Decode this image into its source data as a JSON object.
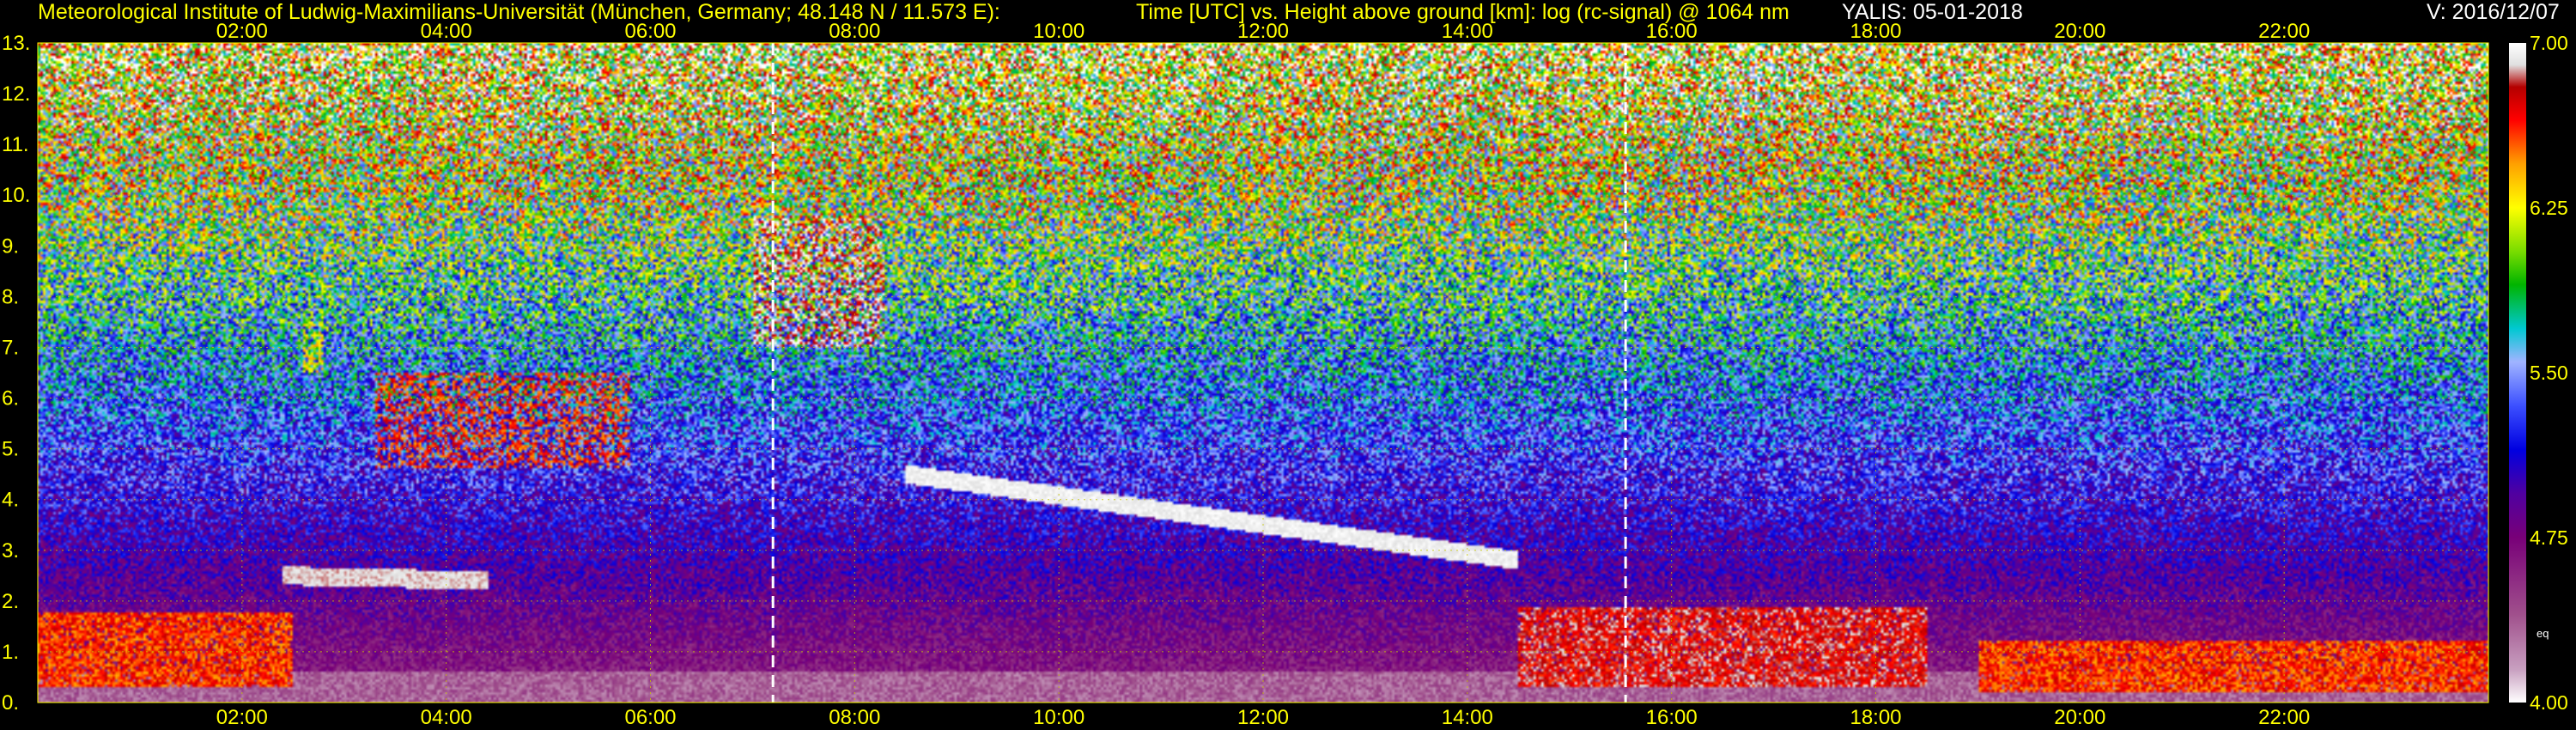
{
  "header": {
    "institute": "Meteorological Institute of Ludwig-Maximilians-Universität (München, Germany; 48.148 N / 11.573 E):",
    "description": "Time [UTC] vs. Height above ground [km]: log (rc-signal) @ 1064 nm",
    "instrument_date": "YALIS: 05-01-2018",
    "version": "V: 2016/12/07"
  },
  "chart_data": {
    "type": "heatmap",
    "title": "Time [UTC] vs. Height above ground [km]: log (rc-signal) @ 1064 nm",
    "x_axis": {
      "unit": "UTC",
      "range_hours": [
        0,
        24
      ],
      "ticks": [
        {
          "hour": 2,
          "label": "02:00"
        },
        {
          "hour": 4,
          "label": "04:00"
        },
        {
          "hour": 6,
          "label": "06:00"
        },
        {
          "hour": 8,
          "label": "08:00"
        },
        {
          "hour": 10,
          "label": "10:00"
        },
        {
          "hour": 12,
          "label": "12:00"
        },
        {
          "hour": 14,
          "label": "14:00"
        },
        {
          "hour": 16,
          "label": "16:00"
        },
        {
          "hour": 18,
          "label": "18:00"
        },
        {
          "hour": 20,
          "label": "20:00"
        },
        {
          "hour": 22,
          "label": "22:00"
        }
      ]
    },
    "y_axis": {
      "unit": "km",
      "range": [
        0,
        13
      ],
      "ticks": [
        {
          "value": 0,
          "label": "0."
        },
        {
          "value": 1,
          "label": "1."
        },
        {
          "value": 2,
          "label": "2."
        },
        {
          "value": 3,
          "label": "3."
        },
        {
          "value": 4,
          "label": "4."
        },
        {
          "value": 5,
          "label": "5."
        },
        {
          "value": 6,
          "label": "6."
        },
        {
          "value": 7,
          "label": "7."
        },
        {
          "value": 8,
          "label": "8."
        },
        {
          "value": 9,
          "label": "9."
        },
        {
          "value": 10,
          "label": "10."
        },
        {
          "value": 11,
          "label": "11."
        },
        {
          "value": 12,
          "label": "12."
        },
        {
          "value": 13,
          "label": "13."
        }
      ]
    },
    "grid": true,
    "grid_color": "#c8c800",
    "marker_lines_hours": [
      7.2,
      15.55
    ],
    "colorbar": {
      "range": [
        4.0,
        7.0
      ],
      "ticks": [
        {
          "value": 7.0,
          "label": "7.00"
        },
        {
          "value": 6.25,
          "label": "6.25"
        },
        {
          "value": 5.5,
          "label": "5.50"
        },
        {
          "value": 4.75,
          "label": "4.75"
        },
        {
          "value": 4.0,
          "label": "4.00"
        }
      ],
      "unit_label": "eq",
      "stops": [
        {
          "value": 4.0,
          "color": "#ffffff"
        },
        {
          "value": 4.15,
          "color": "#c8a0c0"
        },
        {
          "value": 4.4,
          "color": "#a0508c"
        },
        {
          "value": 4.75,
          "color": "#780078"
        },
        {
          "value": 4.95,
          "color": "#5000a0"
        },
        {
          "value": 5.15,
          "color": "#0000e0"
        },
        {
          "value": 5.35,
          "color": "#3c50ff"
        },
        {
          "value": 5.55,
          "color": "#a0b4ff"
        },
        {
          "value": 5.7,
          "color": "#00c8d2"
        },
        {
          "value": 5.9,
          "color": "#00b400"
        },
        {
          "value": 6.05,
          "color": "#78dc00"
        },
        {
          "value": 6.25,
          "color": "#ffff00"
        },
        {
          "value": 6.45,
          "color": "#ffa000"
        },
        {
          "value": 6.65,
          "color": "#ff0000"
        },
        {
          "value": 6.8,
          "color": "#b40000"
        },
        {
          "value": 6.9,
          "color": "#e0e0e0"
        },
        {
          "value": 7.0,
          "color": "#ffffff"
        }
      ]
    },
    "features": [
      {
        "kind": "cirrus",
        "t0": 7.0,
        "t1": 8.3,
        "h0": 7.0,
        "h1": 9.6,
        "value": 6.85
      },
      {
        "kind": "cirrus",
        "t0": 3.3,
        "t1": 5.8,
        "h0": 4.6,
        "h1": 6.5,
        "value": 6.6
      },
      {
        "kind": "cirrus",
        "t0": 2.6,
        "t1": 2.8,
        "h0": 6.5,
        "h1": 7.5,
        "value": 6.3
      },
      {
        "kind": "cloud_layer",
        "t0": 8.5,
        "t1": 14.5,
        "h0": 4.5,
        "h1": 2.8,
        "value": 6.95
      },
      {
        "kind": "cloud_layer",
        "t0": 2.4,
        "t1": 4.4,
        "h0": 2.5,
        "h1": 2.4,
        "value": 6.9
      },
      {
        "kind": "boundary_layer",
        "t0": 0.0,
        "t1": 2.5,
        "h0": 0.3,
        "h1": 1.8,
        "value": 6.6
      },
      {
        "kind": "boundary_layer",
        "t0": 14.5,
        "t1": 18.5,
        "h0": 0.3,
        "h1": 1.9,
        "value": 6.75
      },
      {
        "kind": "boundary_layer",
        "t0": 19.0,
        "t1": 24.0,
        "h0": 0.2,
        "h1": 1.2,
        "value": 6.6
      }
    ]
  }
}
